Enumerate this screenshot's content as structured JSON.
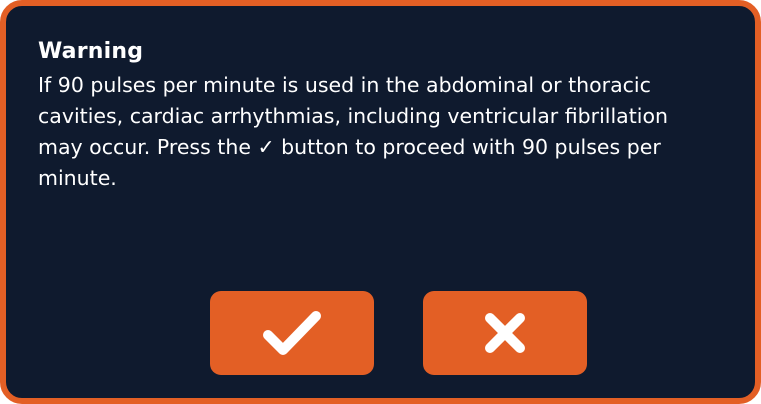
{
  "dialog": {
    "title": "Warning",
    "message": "If 90 pulses per minute is used in the abdominal or thoracic\ncavities, cardiac arrhythmias, including ventricular fibrillation\nmay occur.  Press the ✓ button to proceed with 90 pulses per\nminute.",
    "buttons": [
      {
        "icon": "checkmark-icon",
        "action": "confirm"
      },
      {
        "icon": "close-icon",
        "action": "cancel"
      }
    ]
  },
  "colors": {
    "background": "#0f1a2e",
    "accent": "#e35f25",
    "text": "#ffffff",
    "icon": "#ffffff"
  }
}
